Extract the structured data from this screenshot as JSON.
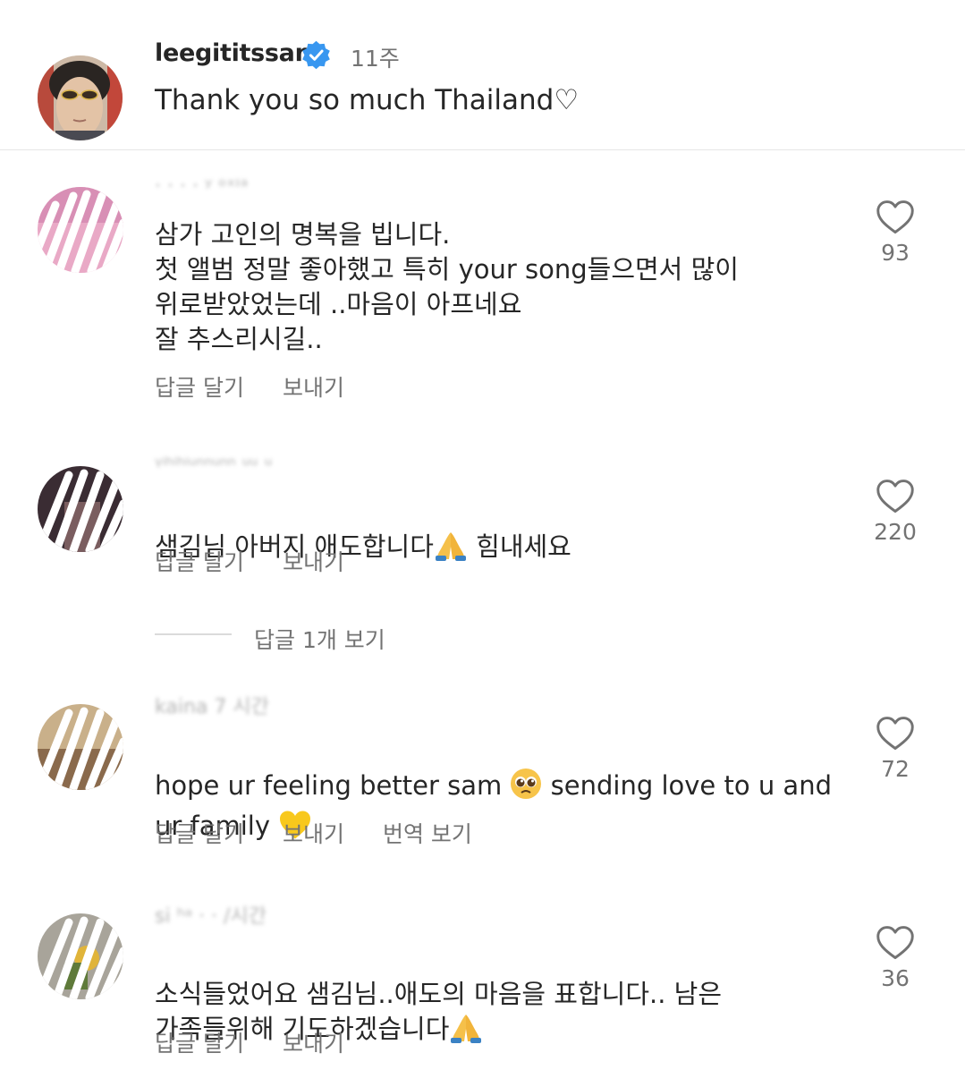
{
  "post": {
    "author": "leegititssam",
    "time": "11주",
    "caption": "Thank you so much Thailand♡"
  },
  "comments": [
    {
      "username_blurred": "· · ·   ·   ʸ ᵒˣᶦᵃ",
      "text_parts": [
        "삼가 고인의 명복을 빕니다.\n첫 앨범 정말 좋아했고 특히 your song들으면서 많이\n위로받았었는데 ..마음이 아프네요\n잘 추스리시길.."
      ],
      "likes": "93",
      "reply": "답글 달기",
      "send": "보내기"
    },
    {
      "username_blurred": "ᵞⁱʰⁱʰⁱᵘⁿⁿᵘⁿⁿ  ᵘᵘ  ᵘ",
      "text_before": "샘김님 아버지 애도합니다",
      "text_after": " 힘내세요",
      "likes": "220",
      "reply": "답글 달기",
      "send": "보내기",
      "view_replies": "답글 1개 보기"
    },
    {
      "username_blurred": "kaina  7 시간",
      "text_line1_before": "hope ur feeling better sam ",
      "text_line1_after": " sending love to u and",
      "text_line2_before": "ur family ",
      "likes": "72",
      "reply": "답글 달기",
      "send": "보내기",
      "translate": "번역 보기"
    },
    {
      "username_blurred": "si ʰᵃ   ·  ·   /시간",
      "text_line1": "소식들었어요 샘김님..애도의 마음을 표합니다.. 남은",
      "text_line2": "가족들위해 기도하겠습니다",
      "likes": "36",
      "reply": "답글 달기",
      "send": "보내기"
    }
  ],
  "colors": {
    "text": "#262626",
    "secondary": "#737373",
    "verified": "#3897f0",
    "divider": "#e6e6e6"
  }
}
